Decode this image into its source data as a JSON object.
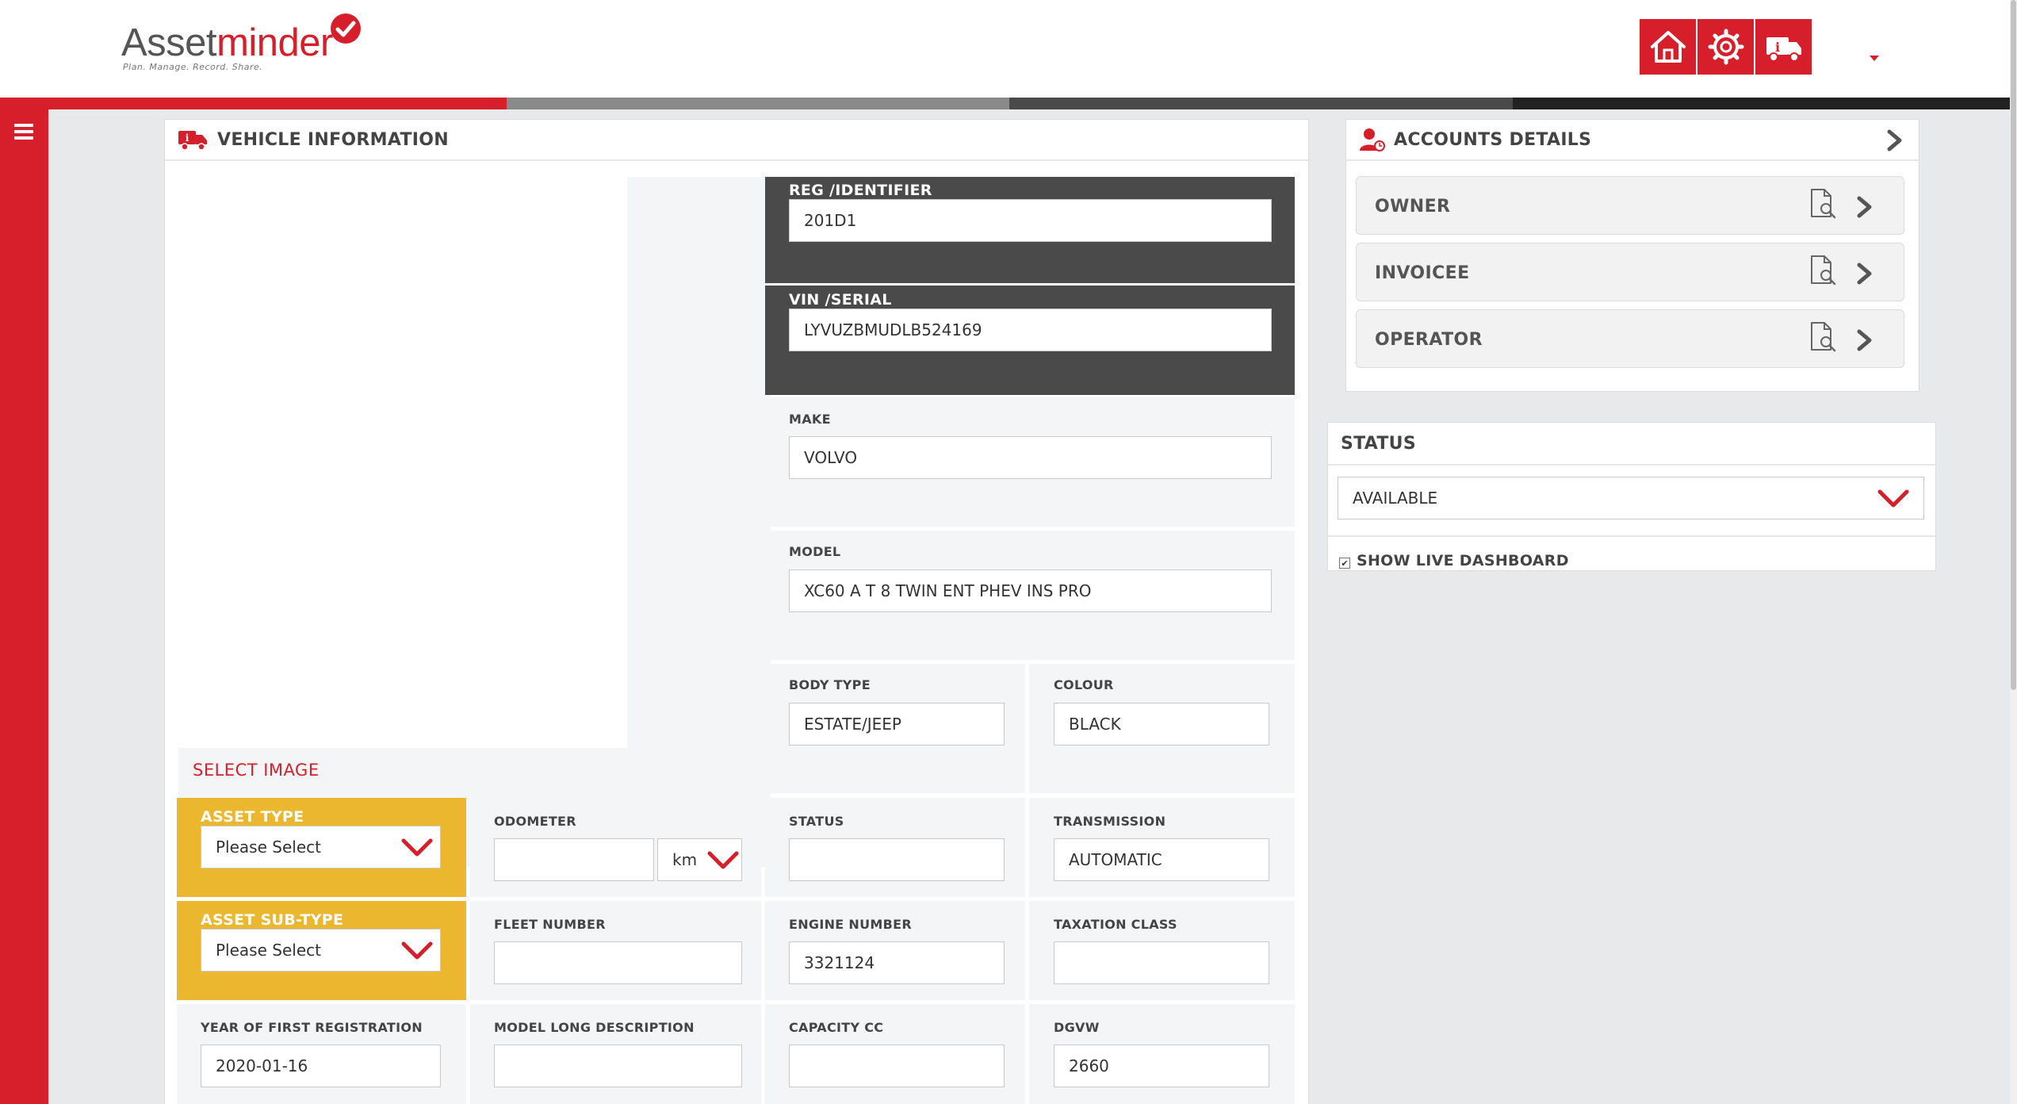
{
  "app": {
    "logo_part1": "Asset",
    "logo_part2": "minder",
    "tagline": "Plan. Manage. Record. Share."
  },
  "header": {
    "buttons": [
      {
        "name": "home",
        "icon": "home-icon"
      },
      {
        "name": "settings",
        "icon": "gear-icon"
      },
      {
        "name": "vehicle-info",
        "icon": "truck-info-icon"
      }
    ],
    "user_menu_icon": "caret-down-icon"
  },
  "progress_strip": [
    "#d71f2b",
    "#8a8a8a",
    "#4a4a4a",
    "#222222"
  ],
  "sidebar": {
    "menu_icon": "hamburger-icon"
  },
  "vehicle_panel": {
    "title": "VEHICLE INFORMATION",
    "select_image": "SELECT IMAGE",
    "reg_label": "REG /IDENTIFIER",
    "reg_value": "201D1",
    "vin_label": "VIN /SERIAL",
    "vin_value": "LYVUZBMUDLB524169",
    "make_label": "MAKE",
    "make_value": "VOLVO",
    "model_label": "MODEL",
    "model_value": "XC60 A T 8 TWIN ENT PHEV INS PRO",
    "body_type_label": "BODY TYPE",
    "body_type_value": "ESTATE/JEEP",
    "colour_label": "COLOUR",
    "colour_value": "BLACK",
    "asset_type_label": "ASSET TYPE",
    "asset_type_value": "Please Select",
    "odometer_label": "ODOMETER",
    "odometer_value": "",
    "odometer_unit": "km",
    "status_label": "STATUS",
    "status_value": "",
    "transmission_label": "TRANSMISSION",
    "transmission_value": "AUTOMATIC",
    "asset_subtype_label": "ASSET SUB-TYPE",
    "asset_subtype_value": "Please Select",
    "fleet_number_label": "FLEET NUMBER",
    "fleet_number_value": "",
    "engine_number_label": "ENGINE NUMBER",
    "engine_number_value": "3321124",
    "taxation_class_label": "TAXATION CLASS",
    "taxation_class_value": "",
    "year_reg_label": "YEAR OF FIRST REGISTRATION",
    "year_reg_value": "2020-01-16",
    "model_long_label": "MODEL LONG DESCRIPTION",
    "model_long_value": "",
    "capacity_label": "CAPACITY CC",
    "capacity_value": "",
    "dgvw_label": "DGVW",
    "dgvw_value": "2660"
  },
  "accounts": {
    "title": "ACCOUNTS DETAILS",
    "items": [
      {
        "label": "OWNER"
      },
      {
        "label": "INVOICEE"
      },
      {
        "label": "OPERATOR"
      }
    ]
  },
  "status_panel": {
    "title": "STATUS",
    "value": "AVAILABLE",
    "show_live_label": "SHOW LIVE DASHBOARD",
    "show_live_checked": true
  },
  "colors": {
    "brand_red": "#d71f2b",
    "gold": "#ebb72e",
    "dark_block": "#4a4a4a"
  }
}
